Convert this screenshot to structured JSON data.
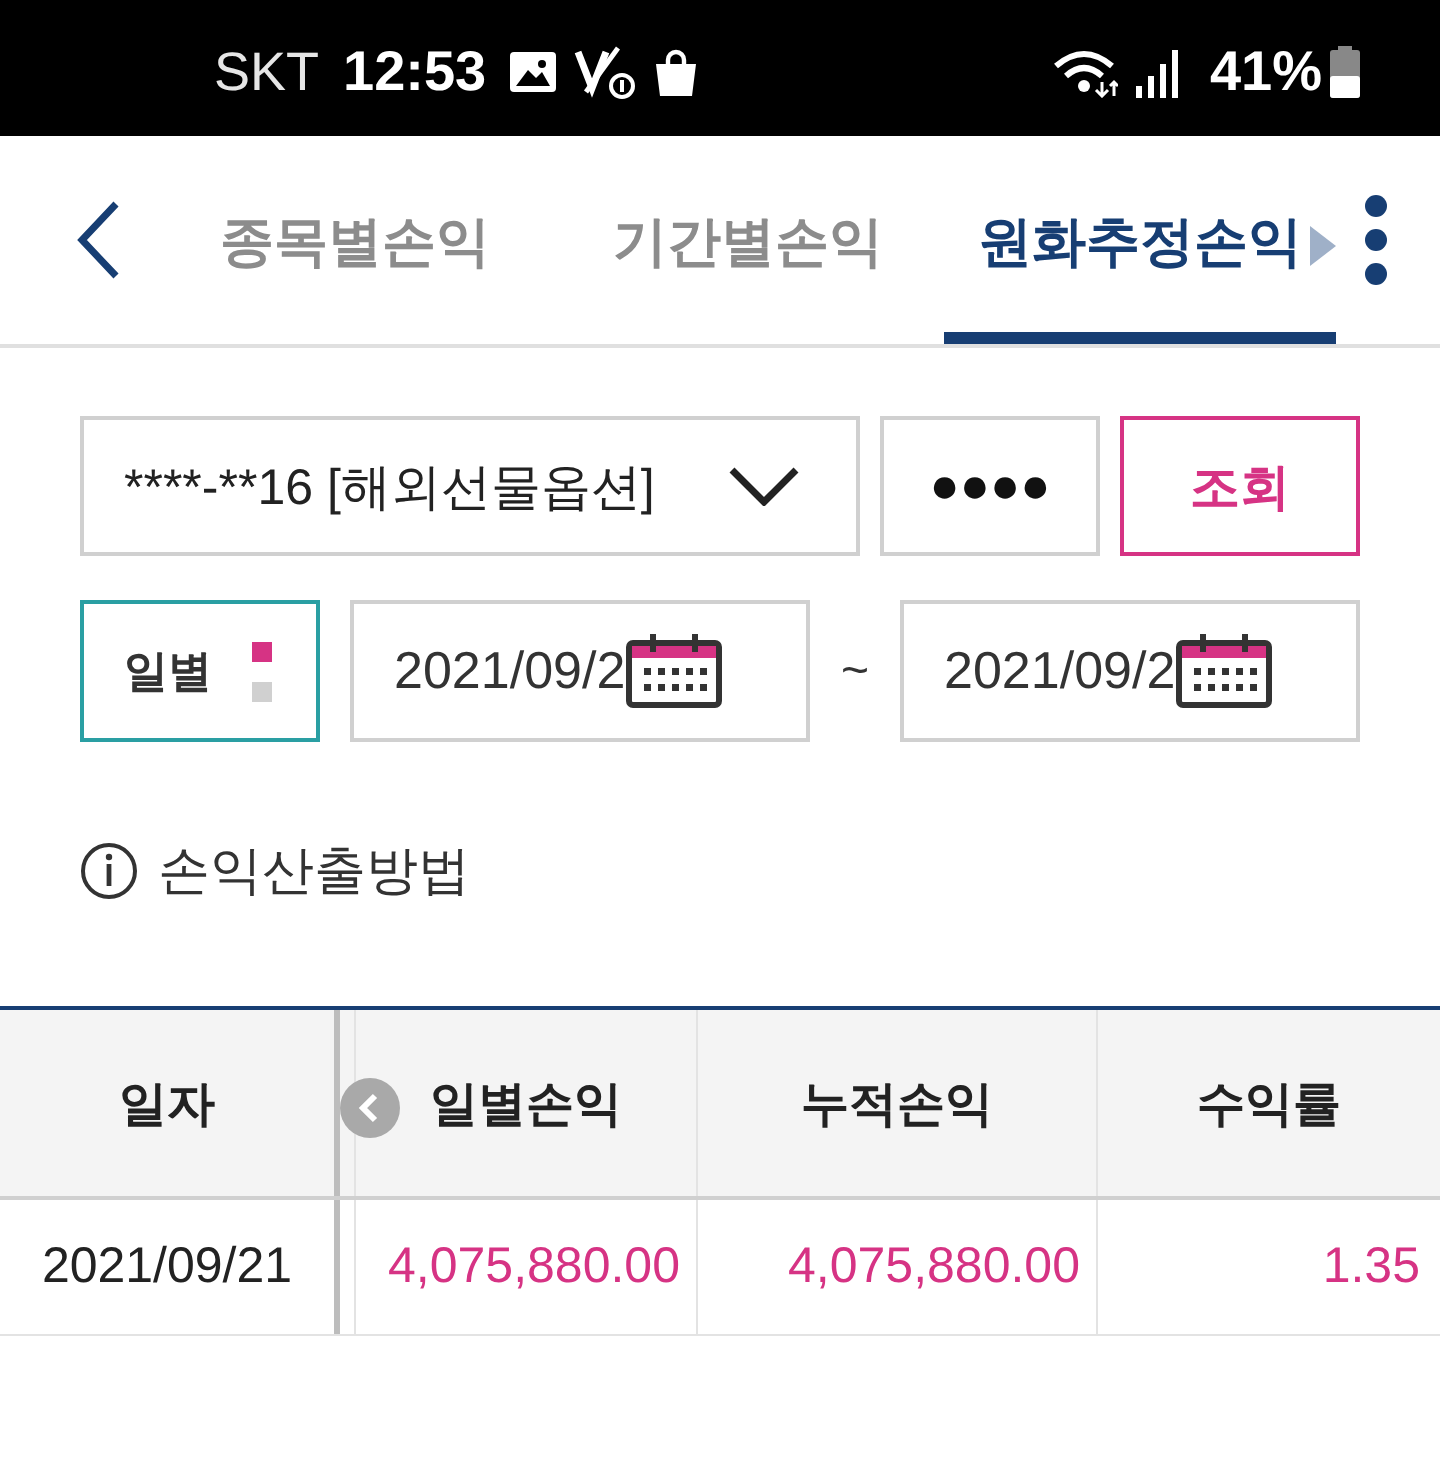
{
  "status_bar": {
    "carrier": "SKT",
    "time": "12:53",
    "battery": "41%"
  },
  "nav": {
    "tabs": [
      {
        "label": "종목별손익",
        "selected": false
      },
      {
        "label": "기간별손익",
        "selected": false
      },
      {
        "label": "원화추정손익",
        "selected": true
      }
    ]
  },
  "query": {
    "account": "****-**16 [해외선물옵션]",
    "password": "●●●●",
    "search_button": "조회"
  },
  "period": {
    "label": "일별",
    "indicator": [
      {
        "selected": true
      },
      {
        "selected": false
      }
    ],
    "date_from": "2021/09/2",
    "separator": "~",
    "date_to": "2021/09/2"
  },
  "info_link": "손익산출방법",
  "table": {
    "columns": [
      "일자",
      "일별손익",
      "누적손익",
      "수익률"
    ],
    "rows": [
      [
        "2021/09/21",
        "4,075,880.00",
        "4,075,880.00",
        "1.35"
      ]
    ]
  }
}
